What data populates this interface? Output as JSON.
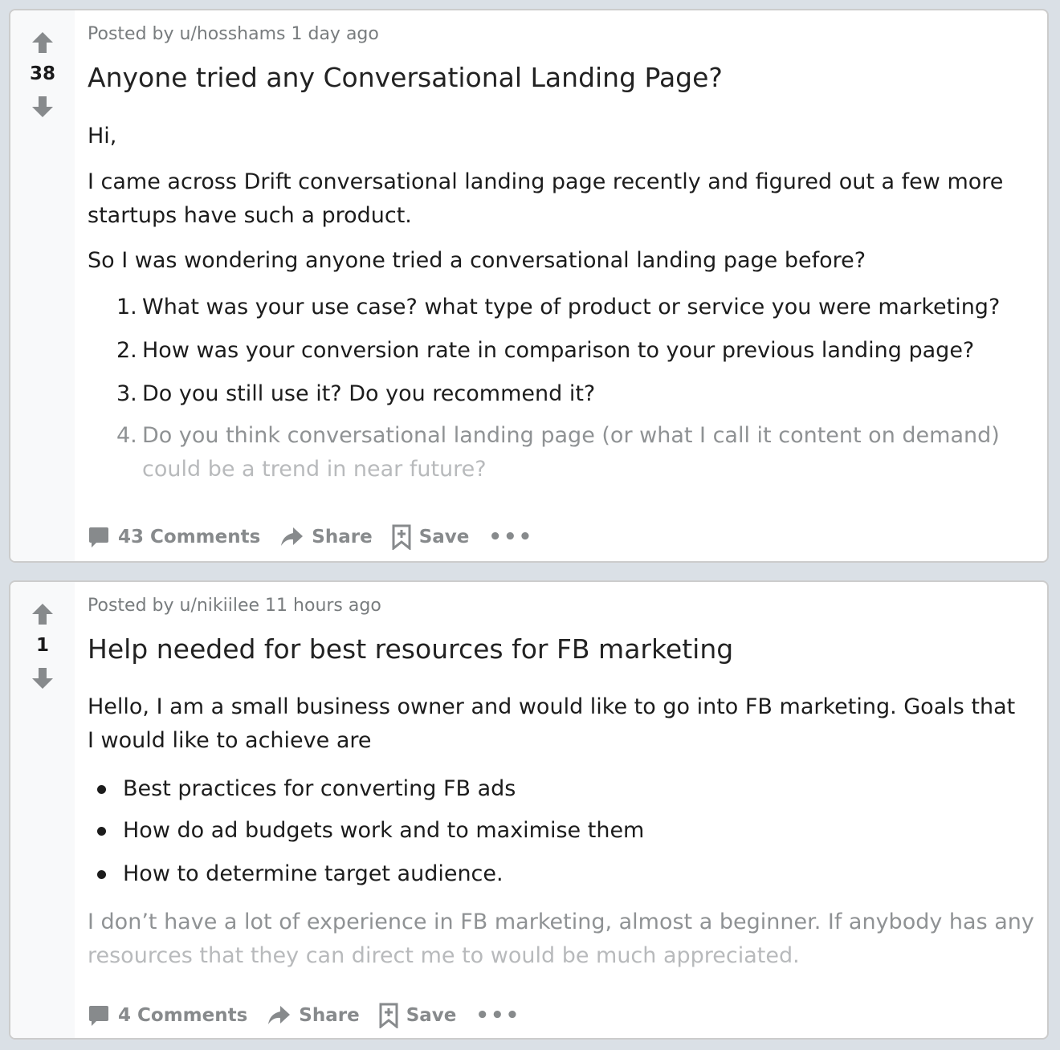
{
  "posts": [
    {
      "score": "38",
      "meta": "Posted by u/hosshams 1 day ago",
      "title": "Anyone tried any Conversational Landing Page?",
      "paragraphs": [
        "Hi,",
        "I came across Drift conversational landing page recently and figured out a few more startups have such a product.",
        "So I was wondering anyone tried a conversational landing page before?"
      ],
      "list": [
        {
          "num": "1.",
          "text": "What was your use case? what type of product or service you were marketing?"
        },
        {
          "num": "2.",
          "text": "How was your conversion rate in comparison to your previous landing page?"
        },
        {
          "num": "3.",
          "text": "Do you still use it? Do you recommend it?"
        },
        {
          "num": "4.",
          "text": "Do you think conversational landing page (or what I call it content on demand)",
          "text2": "could be a trend in near future?"
        }
      ],
      "actions": {
        "comments": "43 Comments",
        "share": "Share",
        "save": "Save",
        "more": "•••"
      }
    },
    {
      "score": "1",
      "meta": "Posted by u/nikiilee 11 hours ago",
      "title": "Help needed for best resources for FB marketing",
      "paragraphs": [
        "Hello, I am a small business owner and would like to go into FB marketing. Goals that I would like to achieve are"
      ],
      "list": [
        {
          "text": "Best practices for converting FB ads"
        },
        {
          "text": "How do ad budgets work and to maximise them"
        },
        {
          "text": "How to determine target audience."
        }
      ],
      "closing": {
        "line1": "I don’t have a lot of experience in FB marketing, almost a beginner. If anybody has any",
        "line2": "resources that they can direct me to would be much appreciated."
      },
      "actions": {
        "comments": "4 Comments",
        "share": "Share",
        "save": "Save",
        "more": "•••"
      }
    }
  ],
  "icons": {
    "upvote": "upvote-arrow-icon",
    "downvote": "downvote-arrow-icon",
    "comment": "comment-bubble-icon",
    "share": "share-arrow-icon",
    "save": "bookmark-plus-icon",
    "more": "more-options-icon"
  },
  "colors": {
    "background": "#dae0e6",
    "card": "#ffffff",
    "vote_column": "#f8f9fa",
    "muted": "#878a8c",
    "text": "#1c1c1c"
  }
}
